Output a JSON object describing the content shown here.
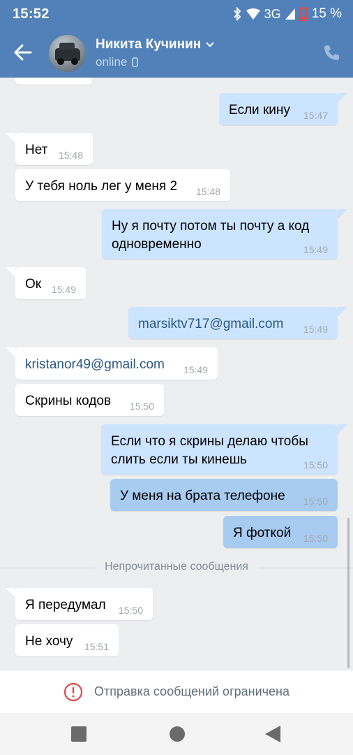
{
  "status_bar": {
    "time": "15:52",
    "network": "3G",
    "battery": "15 %"
  },
  "header": {
    "contact_name": "Никита Кучинин",
    "presence": "online"
  },
  "messages": [
    {
      "dir": "out",
      "text": "Если кину",
      "time": "15:47"
    },
    {
      "dir": "in",
      "text": "Нет",
      "time": "15:48"
    },
    {
      "dir": "in",
      "text": "У тебя ноль лег у меня 2",
      "time": "15:48"
    },
    {
      "dir": "out",
      "line1": "Ну я почту потом ты почту а код",
      "line2": "одновременно",
      "time": "15:49"
    },
    {
      "dir": "in",
      "text": "Ок",
      "time": "15:49"
    },
    {
      "dir": "out",
      "text": "marsiktv717@gmail.com",
      "time": "15:49"
    },
    {
      "dir": "in",
      "text": "kristanor49@gmail.com",
      "time": "15:49"
    },
    {
      "dir": "in",
      "text": "Скрины кодов",
      "time": "15:50"
    },
    {
      "dir": "out",
      "line1": "Если что я скрины делаю чтобы",
      "line2": "слить если ты кинешь",
      "time": "15:50"
    },
    {
      "dir": "out",
      "text": "У меня на брата телефоне",
      "time": "15:50"
    },
    {
      "dir": "out",
      "text": "Я фоткой",
      "time": "15:50"
    },
    {
      "dir": "in",
      "text": "Я передумал",
      "time": "15:50"
    },
    {
      "dir": "in",
      "text": "Не хочу",
      "time": "15:51"
    }
  ],
  "unread_divider": "Непрочитанные сообщения",
  "restriction_notice": "Отправка сообщений ограничена",
  "colors": {
    "header": "#5181b8",
    "outgoing_bubble": "#cce4ff",
    "selected_bubble": "#a8cbf2",
    "background": "#edeef0",
    "warning": "#e64646"
  }
}
